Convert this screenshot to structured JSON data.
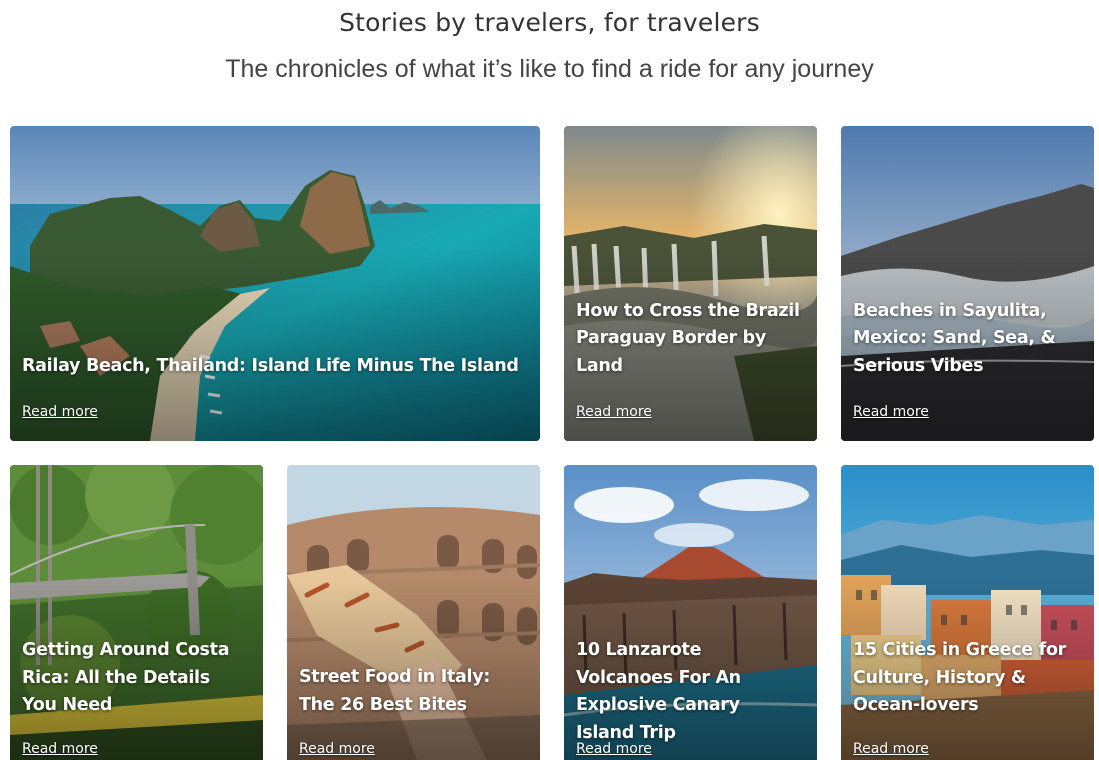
{
  "header": {
    "title": "Stories by travelers, for travelers",
    "subtitle": "The chronicles of what it’s like to find a ride for any journey"
  },
  "cards": [
    {
      "title": "Railay Beach, Thailand: Island Life Minus The Island",
      "link": "Read more"
    },
    {
      "title": "How to Cross the Brazil Paraguay Border by Land",
      "link": "Read more"
    },
    {
      "title": "Beaches in Sayulita, Mexico: Sand, Sea, & Serious Vibes",
      "link": "Read more"
    },
    {
      "title": "Getting Around Costa Rica: All the Details You Need",
      "link": "Read more"
    },
    {
      "title": "Street Food in Italy: The 26 Best Bites",
      "link": "Read more"
    },
    {
      "title": "10 Lanzarote Volcanoes For An Explosive Canary Island Trip",
      "link": "Read more"
    },
    {
      "title": "15 Cities in Greece for Culture, History & Ocean-lovers",
      "link": "Read more"
    }
  ]
}
